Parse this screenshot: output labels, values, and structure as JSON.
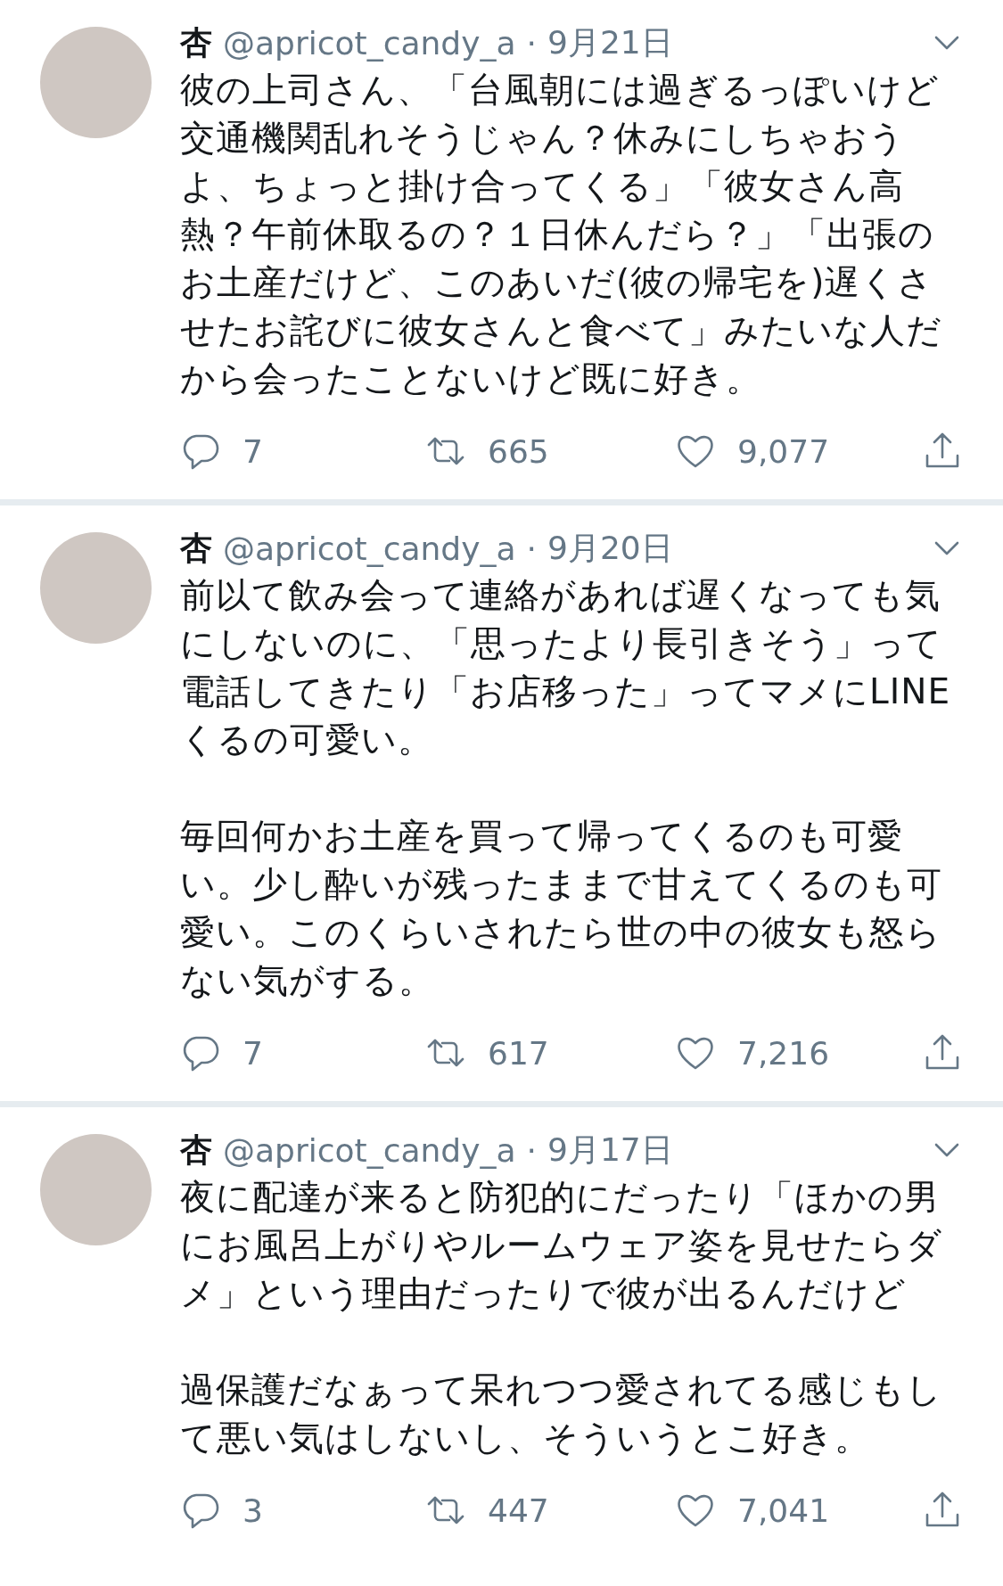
{
  "tweets": [
    {
      "name": "杏",
      "handle": "@apricot_candy_a",
      "dot": "·",
      "date": "9月21日",
      "paragraphs": [
        "彼の上司さん、「台風朝には過ぎるっぽいけど交通機関乱れそうじゃん？休みにしちゃおうよ、ちょっと掛け合ってくる」「彼女さん高熱？午前休取るの？１日休んだら？」「出張のお土産だけど、このあいだ(彼の帰宅を)遅くさせたお詫びに彼女さんと食べて」みたいな人だから会ったことないけど既に好き。"
      ],
      "replies": "7",
      "retweets": "665",
      "likes": "9,077"
    },
    {
      "name": "杏",
      "handle": "@apricot_candy_a",
      "dot": "·",
      "date": "9月20日",
      "paragraphs": [
        "前以て飲み会って連絡があれば遅くなっても気にしないのに、「思ったより長引きそう」って電話してきたり「お店移った」ってマメにLINEくるの可愛い。",
        "毎回何かお土産を買って帰ってくるのも可愛い。少し酔いが残ったままで甘えてくるのも可愛い。このくらいされたら世の中の彼女も怒らない気がする。"
      ],
      "replies": "7",
      "retweets": "617",
      "likes": "7,216"
    },
    {
      "name": "杏",
      "handle": "@apricot_candy_a",
      "dot": "·",
      "date": "9月17日",
      "paragraphs": [
        "夜に配達が来ると防犯的にだったり「ほかの男にお風呂上がりやルームウェア姿を見せたらダメ」という理由だったりで彼が出るんだけど",
        "過保護だなぁって呆れつつ愛されてる感じもして悪い気はしないし、そういうとこ好き。"
      ],
      "replies": "3",
      "retweets": "447",
      "likes": "7,041"
    }
  ]
}
